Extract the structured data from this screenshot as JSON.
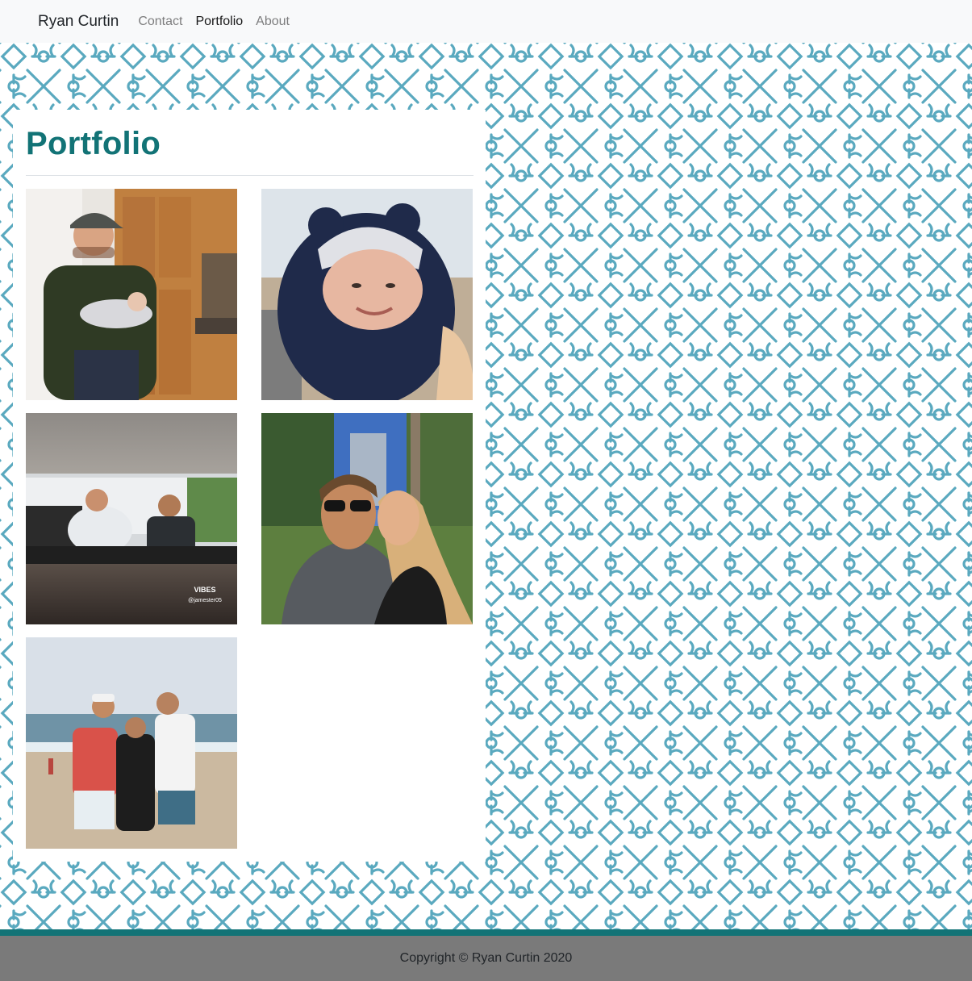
{
  "navbar": {
    "brand": "Ryan Curtin",
    "links": [
      {
        "label": "Contact",
        "active": false
      },
      {
        "label": "Portfolio",
        "active": true
      },
      {
        "label": "About",
        "active": false
      }
    ]
  },
  "main": {
    "title": "Portfolio",
    "photos": [
      {
        "name": "photo-man-holding-baby"
      },
      {
        "name": "photo-baby-in-hood"
      },
      {
        "name": "photo-family-on-porch",
        "caption_lines": [
          "VIBES",
          "@jamester05"
        ]
      },
      {
        "name": "photo-couple-selfie"
      },
      {
        "name": "photo-family-at-beach"
      }
    ]
  },
  "footer": {
    "copyright": "Copyright © Ryan Curtin 2020"
  },
  "colors": {
    "accent": "#127376",
    "pattern": "#5aa9bf",
    "footer_bg": "#7a7a7a"
  }
}
